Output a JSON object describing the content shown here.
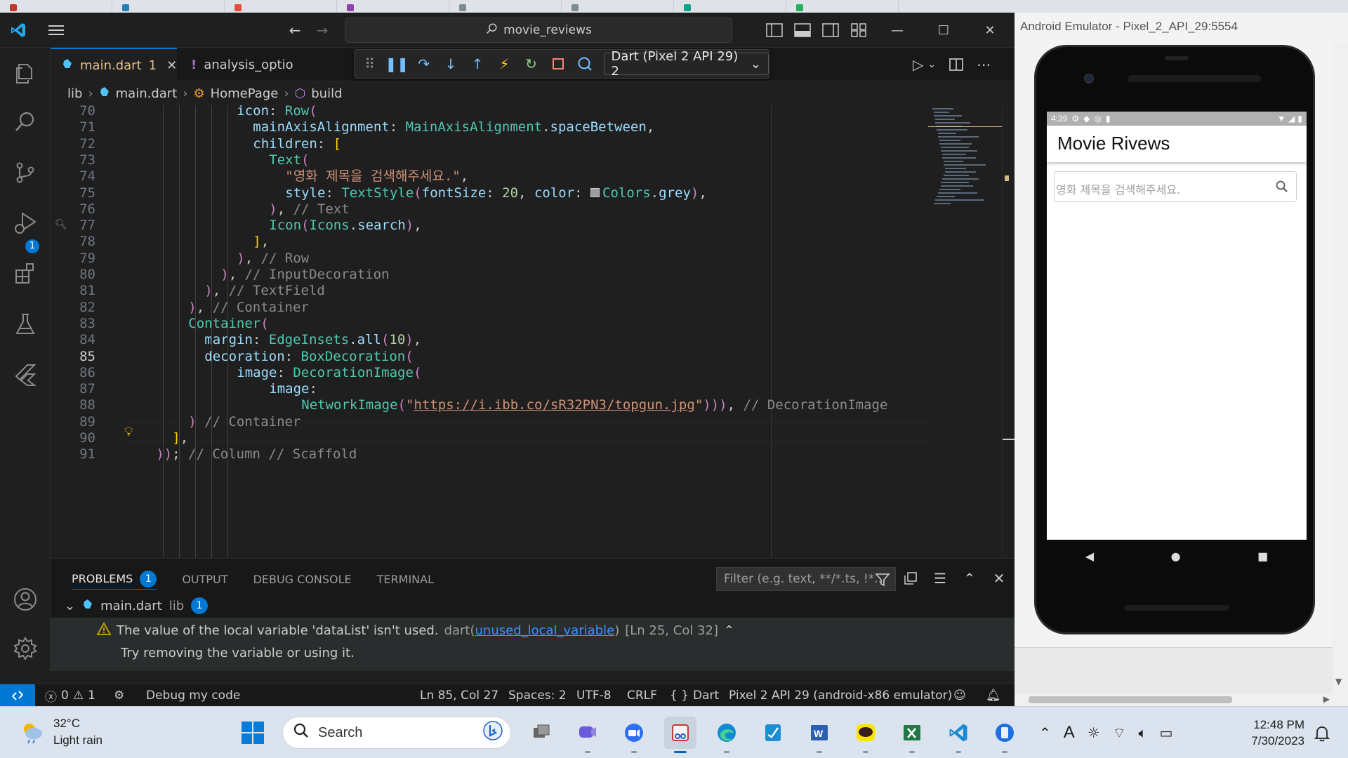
{
  "vscode": {
    "search_text": "movie_reviews",
    "tabs": [
      {
        "label": "main.dart",
        "problems": "1"
      },
      {
        "label": "analysis_optio"
      }
    ],
    "debug_target": "Dart (Pixel 2 API 29) 2",
    "activity_badge": "1",
    "breadcrumbs": [
      "lib",
      "main.dart",
      "HomePage",
      "build"
    ],
    "code_lines": [
      {
        "n": "70",
        "text": "icon: Row("
      },
      {
        "n": "71",
        "text": "mainAxisAlignment: MainAxisAlignment.spaceBetween,"
      },
      {
        "n": "72",
        "text": "children: ["
      },
      {
        "n": "73",
        "text": "Text("
      },
      {
        "n": "74",
        "text": "\"영화 제목을 검색해주세요.\","
      },
      {
        "n": "75",
        "text": "style: TextStyle(fontSize: 20, color: Colors.grey),"
      },
      {
        "n": "76",
        "text": "), // Text"
      },
      {
        "n": "77",
        "text": "Icon(Icons.search),"
      },
      {
        "n": "78",
        "text": "],"
      },
      {
        "n": "79",
        "text": "), // Row"
      },
      {
        "n": "80",
        "text": "), // InputDecoration"
      },
      {
        "n": "81",
        "text": "), // TextField"
      },
      {
        "n": "82",
        "text": "), // Container"
      },
      {
        "n": "83",
        "text": "Container("
      },
      {
        "n": "84",
        "text": "margin: EdgeInsets.all(10),"
      },
      {
        "n": "85",
        "text": "decoration: BoxDecoration("
      },
      {
        "n": "86",
        "text": "image: DecorationImage("
      },
      {
        "n": "87",
        "text": "image:"
      },
      {
        "n": "88",
        "text": "NetworkImage(\"https://i.ibb.co/sR32PN3/topgun.jpg\"))), // DecorationImage"
      },
      {
        "n": "89",
        "text": ") // Container"
      },
      {
        "n": "90",
        "text": "],"
      },
      {
        "n": "91",
        "text": ")); // Column // Scaffold"
      }
    ],
    "panel": {
      "tabs": [
        "PROBLEMS",
        "OUTPUT",
        "DEBUG CONSOLE",
        "TERMINAL"
      ],
      "problems_count": "1",
      "filter_placeholder": "Filter (e.g. text, **/*.ts, !*...",
      "file_name": "main.dart",
      "file_dir": "lib",
      "file_count": "1",
      "message": "The value of the local variable 'dataList' isn't used.",
      "source_prefix": "dart(",
      "code_link": "unused_local_variable",
      "source_suffix": ")",
      "location": "[Ln 25, Col 32]",
      "hint": "Try removing the variable or using it."
    },
    "status": {
      "errors": "0",
      "warnings": "1",
      "debug_label": "Debug my code",
      "position": "Ln 85, Col 27",
      "spaces": "Spaces: 2",
      "encoding": "UTF-8",
      "eol": "CRLF",
      "language": "Dart",
      "device": "Pixel 2 API 29 (android-x86 emulator)"
    }
  },
  "emulator": {
    "title": "Android Emulator - Pixel_2_API_29:5554",
    "status_time": "4:39",
    "app_title": "Movie Rivews",
    "search_placeholder": "영화 제목을 검색해주세요."
  },
  "taskbar": {
    "temperature": "32°C",
    "weather": "Light rain",
    "search_label": "Search",
    "time": "12:48 PM",
    "date": "7/30/2023"
  },
  "colors": {
    "accent": "#0078d4",
    "editor_bg": "#1f1f1f",
    "keyword_purple": "#c586c0",
    "class_teal": "#4ec9b0",
    "property_blue": "#9cdcfe",
    "string_orange": "#ce9178",
    "comment_gray": "#8b8b8b"
  }
}
